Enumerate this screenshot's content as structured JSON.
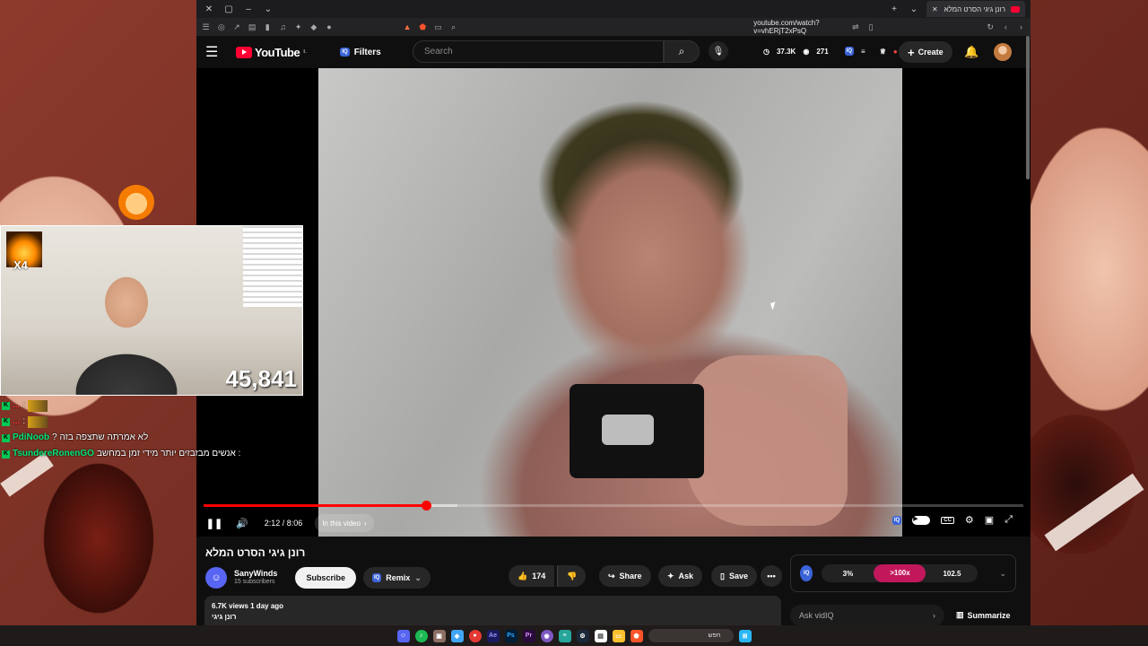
{
  "browser": {
    "tab_title": "רונן גיגי הסרט המלא - YouTube",
    "url": "youtube.com/watch?v=vhERjT2xPsQ"
  },
  "masthead": {
    "logo_text": "YouTube",
    "logo_region": "IL",
    "filters_label": "Filters",
    "iq_label": "IQ",
    "search_placeholder": "Search",
    "stat_views": "37.3K",
    "stat_watching": "271",
    "create_label": "Create"
  },
  "player": {
    "current_time": "2:12 / 8:06",
    "progress_fraction": 0.2716,
    "chapter_label": "In this video",
    "iq_label": "IQ"
  },
  "video": {
    "title": "רונן גיגי הסרט המלא",
    "channel_name": "SanyWinds",
    "subscribers": "15 subscribers",
    "subscribe_label": "Subscribe",
    "remix_label": "Remix",
    "likes": "174",
    "share_label": "Share",
    "ask_label": "Ask",
    "save_label": "Save",
    "views_date": "6.7K views  1 day ago",
    "description_snippet": "רונן גיגי"
  },
  "vidiq": {
    "badge": "IQ",
    "stat_1": "3%",
    "stat_2": ">100x",
    "stat_3": "102.5",
    "ask_placeholder": "Ask vidIQ",
    "summarize_label": "Summarize"
  },
  "stream": {
    "multiplier": "X4",
    "counter": "45,841",
    "chat": [
      {
        "user": "...",
        "msg": ":",
        "emote": true
      },
      {
        "user": "...",
        "msg": ":",
        "emote": true
      },
      {
        "user": "PdiNoob",
        "msg": "לא אמרתה שתצפה בזה ?",
        "emote": false
      },
      {
        "user": "TsundereRonenGO",
        "msg": ": אנשים מבזבזים יותר מידי זמן במחשב",
        "emote": false
      }
    ]
  },
  "taskbar": {
    "search_label": "חפש"
  },
  "colors": {
    "accent_red": "#ff0000",
    "vidiq_blue": "#3a63d8",
    "vidiq_pink": "#c2185b",
    "chat_green": "#00c853"
  }
}
